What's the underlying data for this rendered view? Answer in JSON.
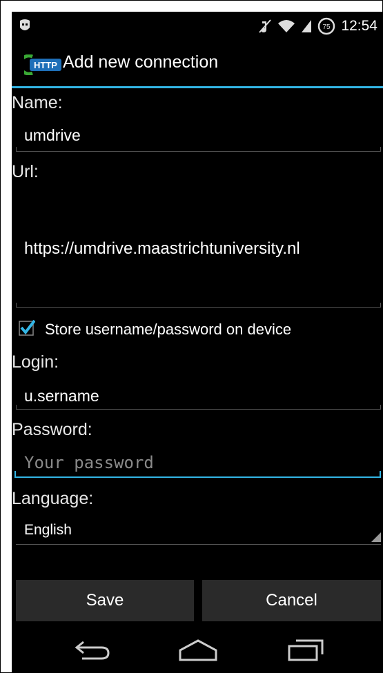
{
  "status_bar": {
    "time": "12:54",
    "battery_level": "75",
    "icons": [
      "debug-icon",
      "mute-icon",
      "wifi-icon",
      "signal-icon",
      "battery-icon"
    ]
  },
  "action_bar": {
    "app_icon_text": "HTTP",
    "title": "Add new connection"
  },
  "form": {
    "name_label": "Name:",
    "name_value": "umdrive",
    "url_label": "Url:",
    "url_value": "https://umdrive.maastrichtuniversity.nl",
    "store_checkbox_label": "Store username/password on device",
    "store_checked": true,
    "login_label": "Login:",
    "login_value": "u.sername",
    "password_label": "Password:",
    "password_placeholder": "Your password",
    "language_label": "Language:",
    "language_value": "English"
  },
  "buttons": {
    "save": "Save",
    "cancel": "Cancel"
  },
  "nav_bar": {
    "icons": [
      "back-icon",
      "home-icon",
      "recents-icon"
    ]
  },
  "colors": {
    "accent": "#33b5e5",
    "background": "#000000",
    "button": "#2a2a2a",
    "app_icon_green": "#3aa935"
  }
}
